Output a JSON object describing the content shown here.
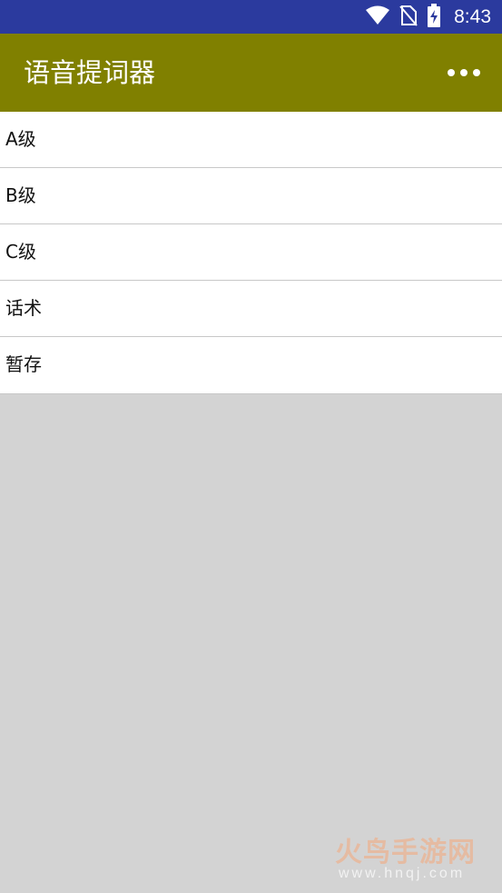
{
  "status_bar": {
    "time": "8:43",
    "icons": [
      "wifi-icon",
      "no-sim-icon",
      "battery-charging-icon"
    ]
  },
  "app_bar": {
    "title": "语音提词器",
    "menu_icon": "overflow-menu-icon"
  },
  "list": {
    "items": [
      {
        "label": "A级"
      },
      {
        "label": "B级"
      },
      {
        "label": "C级"
      },
      {
        "label": "话术"
      },
      {
        "label": "暂存"
      }
    ]
  },
  "watermark": {
    "logo_text": "火鸟手游网",
    "url": "www.hnqj.com"
  },
  "colors": {
    "status_bar": "#2b3a9e",
    "app_bar": "#808000",
    "list_bg": "#ffffff",
    "screen_bg": "#d3d3d3"
  }
}
